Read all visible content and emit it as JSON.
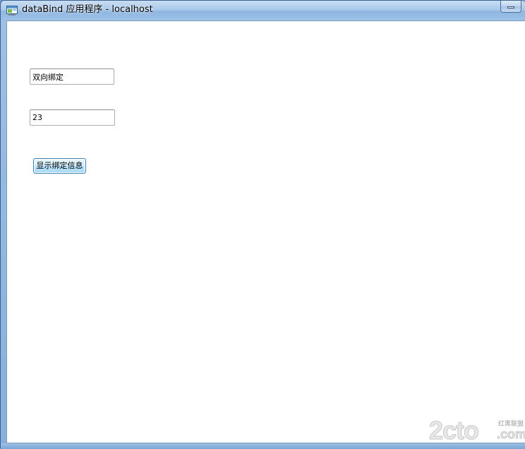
{
  "window": {
    "title": "dataBind 应用程序 - localhost",
    "icon": "app-window-icon"
  },
  "form": {
    "text_field_1": {
      "value": "双向绑定"
    },
    "text_field_2": {
      "value": "23"
    },
    "show_button_label": "显示绑定信息"
  },
  "watermark": {
    "main": "2cto",
    "chinese": "红黑联盟",
    "suffix": ".com"
  },
  "colors": {
    "title_bar": "#a9c8ea",
    "frame": "#86afdc",
    "client_background": "#ffffff",
    "button_accent": "#3c7fb1"
  }
}
